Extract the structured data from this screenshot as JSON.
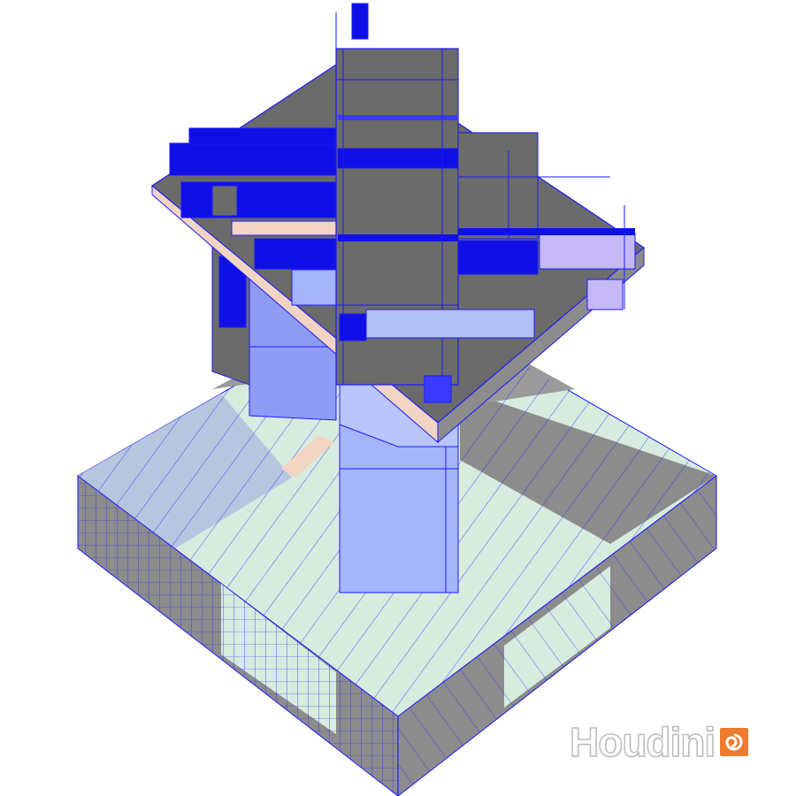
{
  "viewport": {
    "background": "#ffffff",
    "content": "isometric-wireframe-building-model"
  },
  "colors": {
    "wire": "#1a1aff",
    "deep_blue": "#0f0fe6",
    "dark_grey": "#6b6b6b",
    "mid_grey": "#8c8c8c",
    "light_blue": "#8f9cf5",
    "pale_blue": "#b3bff7",
    "pale_green": "#d7ecdf",
    "steel_blue": "#b7c6df",
    "lavender": "#c5b8f7",
    "peach": "#f2d4c2"
  },
  "watermark": {
    "text": "Houdini",
    "logo": "houdini-swirl-icon",
    "logo_color": "#f07a2e"
  }
}
